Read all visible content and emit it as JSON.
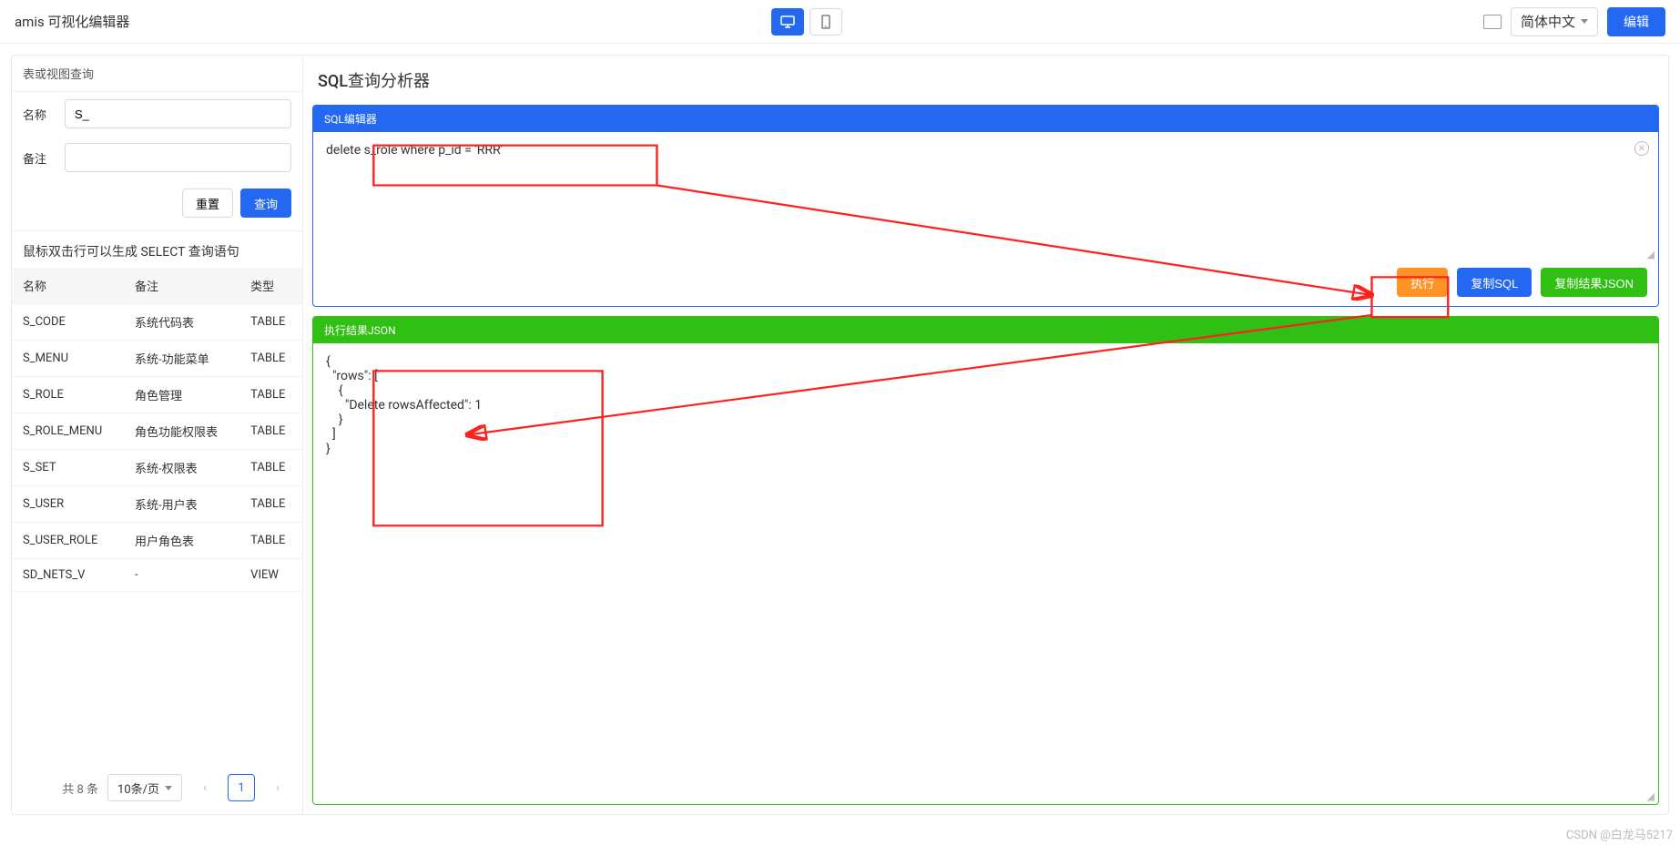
{
  "topbar": {
    "title": "amis 可视化编辑器",
    "language": "简体中文",
    "edit_label": "编辑"
  },
  "sidebar": {
    "panel_title": "表或视图查询",
    "name_label": "名称",
    "name_value": "S_",
    "remark_label": "备注",
    "remark_value": "",
    "reset_label": "重置",
    "query_label": "查询",
    "hint": "鼠标双击行可以生成 SELECT 查询语句",
    "columns": {
      "name": "名称",
      "remark": "备注",
      "type": "类型"
    },
    "rows": [
      {
        "name": "S_CODE",
        "remark": "系统代码表",
        "type": "TABLE"
      },
      {
        "name": "S_MENU",
        "remark": "系统-功能菜单",
        "type": "TABLE"
      },
      {
        "name": "S_ROLE",
        "remark": "角色管理",
        "type": "TABLE"
      },
      {
        "name": "S_ROLE_MENU",
        "remark": "角色功能权限表",
        "type": "TABLE"
      },
      {
        "name": "S_SET",
        "remark": "系统-权限表",
        "type": "TABLE"
      },
      {
        "name": "S_USER",
        "remark": "系统-用户表",
        "type": "TABLE"
      },
      {
        "name": "S_USER_ROLE",
        "remark": "用户角色表",
        "type": "TABLE"
      },
      {
        "name": "SD_NETS_V",
        "remark": "-",
        "type": "VIEW"
      }
    ],
    "pagination": {
      "total_text": "共 8 条",
      "per_page": "10条/页",
      "page": "1"
    }
  },
  "main": {
    "title": "SQL查询分析器",
    "editor_head": "SQL编辑器",
    "sql_value": "delete s_role where p_id = 'RRR'",
    "exec_label": "执行",
    "copy_sql_label": "复制SQL",
    "copy_json_label": "复制结果JSON",
    "result_head": "执行结果JSON",
    "result_json": "{\n  \"rows\": [\n    {\n      \"Delete rowsAffected\": 1\n    }\n  ]\n}"
  },
  "watermark": "CSDN @白龙马5217"
}
